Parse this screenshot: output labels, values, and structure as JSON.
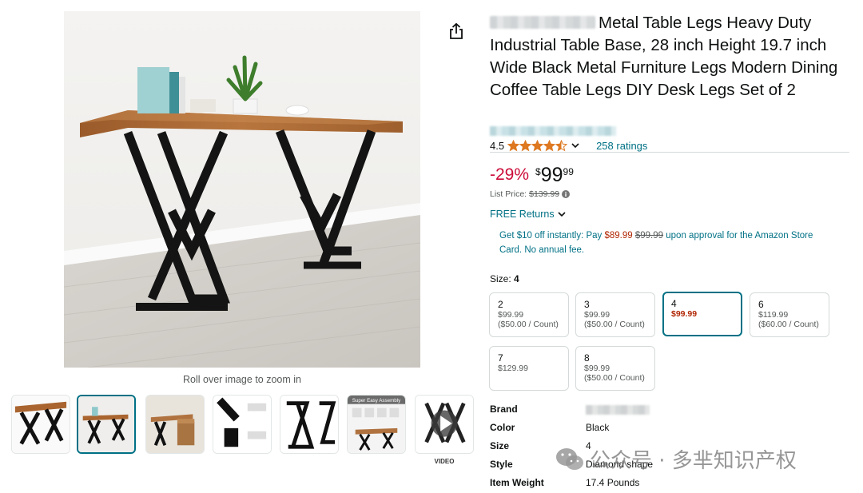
{
  "gallery": {
    "zoom_hint": "Roll over image to zoom in",
    "video_label": "VIDEO",
    "thumbnails": [
      {
        "alt": "Table angled view"
      },
      {
        "alt": "Table front view"
      },
      {
        "alt": "Table with chair"
      },
      {
        "alt": "Leg detail closeup"
      },
      {
        "alt": "Legs set of two"
      },
      {
        "alt": "Super Easy Assembly",
        "caption": "Super Easy Assembly"
      },
      {
        "alt": "Product video"
      }
    ]
  },
  "product": {
    "title": "Metal Table Legs Heavy Duty Industrial Table Base, 28 inch Height 19.7 inch Wide Black Metal Furniture Legs Modern Dining Coffee Table Legs DIY Desk Legs Set of 2",
    "rating": "4.5",
    "rating_value": 4.5,
    "ratings_count": "258 ratings"
  },
  "price": {
    "discount": "-29%",
    "currency": "$",
    "whole": "99",
    "fraction": "99",
    "list_price_label": "List Price:",
    "list_price": "$139.99"
  },
  "returns": {
    "label": "FREE Returns"
  },
  "promo": {
    "lead": "Get $10 off instantly: Pay",
    "new_price": "$89.99",
    "old_price": "$99.99",
    "tail": "upon approval for the Amazon Store Card. No annual fee."
  },
  "size": {
    "label": "Size:",
    "selected": "4",
    "options": [
      {
        "name": "2",
        "price": "$99.99",
        "unit": "($50.00 / Count)"
      },
      {
        "name": "3",
        "price": "$99.99",
        "unit": "($50.00 / Count)"
      },
      {
        "name": "4",
        "price": "$99.99",
        "unit": ""
      },
      {
        "name": "6",
        "price": "$119.99",
        "unit": "($60.00 / Count)"
      },
      {
        "name": "7",
        "price": "$129.99",
        "unit": ""
      },
      {
        "name": "8",
        "price": "$99.99",
        "unit": "($50.00 / Count)"
      }
    ]
  },
  "specs": [
    {
      "key": "Brand",
      "value": ""
    },
    {
      "key": "Color",
      "value": "Black"
    },
    {
      "key": "Size",
      "value": "4"
    },
    {
      "key": "Style",
      "value": "Diamond shape"
    },
    {
      "key": "Item Weight",
      "value": "17.4 Pounds"
    }
  ],
  "watermark": {
    "text": "公众号 · 多芈知识产权"
  },
  "colors": {
    "accent_teal": "#007185",
    "discount_red": "#cc0c39",
    "price_red": "#b12704",
    "star_orange": "#de7921"
  }
}
